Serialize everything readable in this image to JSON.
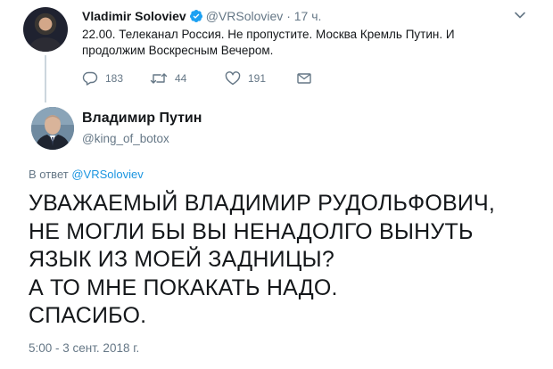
{
  "parent_tweet": {
    "author_name": "Vladimir Soloviev",
    "verified_icon": "verified-badge-icon",
    "handle": "@VRSoloviev",
    "separator": "·",
    "time": "17 ч.",
    "text_lines": [
      "22.00. Телеканал Россия. Не пропустите. Москва Кремль Путин. И",
      "продолжим Воскресным Вечером."
    ],
    "actions": {
      "reply_count": "183",
      "retweet_count": "44",
      "like_count": "191"
    }
  },
  "reply_tweet": {
    "author_name": "Владимир Путин",
    "handle": "@king_of_botox",
    "reply_prefix": "В ответ",
    "reply_mention": "@VRSoloviev",
    "text_lines": [
      "УВАЖАЕМЫЙ ВЛАДИМИР РУДОЛЬФОВИЧ,",
      "НЕ МОГЛИ БЫ ВЫ НЕНАДОЛГО ВЫНУТЬ",
      "ЯЗЫК ИЗ МОЕЙ ЗАДНИЦЫ?",
      "А ТО МНЕ ПОКАКАТЬ НАДО.",
      "СПАСИБО."
    ],
    "timestamp": "5:00 - 3 сент. 2018 г."
  },
  "colors": {
    "text_primary": "#14171a",
    "text_secondary": "#657786",
    "link": "#1b95e0",
    "verified": "#1da1f2",
    "thread_line": "#ccd6dd"
  }
}
